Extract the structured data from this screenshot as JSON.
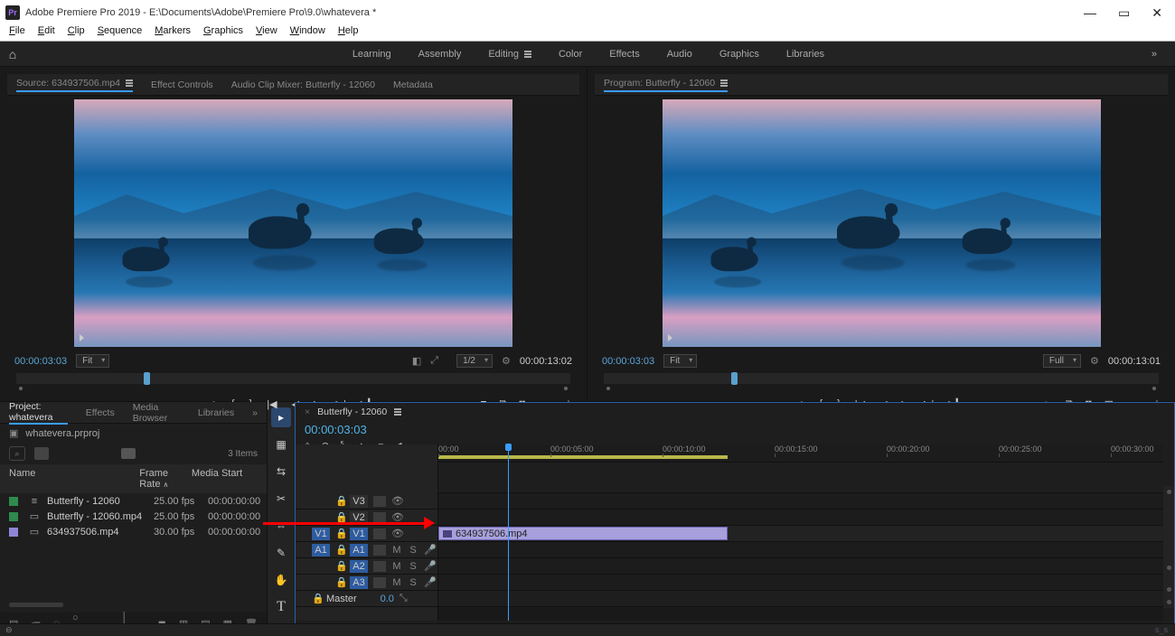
{
  "title": "Adobe Premiere Pro 2019 - E:\\Documents\\Adobe\\Premiere Pro\\9.0\\whatevera *",
  "menu": [
    "File",
    "Edit",
    "Clip",
    "Sequence",
    "Markers",
    "Graphics",
    "View",
    "Window",
    "Help"
  ],
  "workspaces": [
    "Learning",
    "Assembly",
    "Editing",
    "Color",
    "Effects",
    "Audio",
    "Graphics",
    "Libraries"
  ],
  "workspace_active": "Editing",
  "source": {
    "tab_label": "Source: 634937506.mp4",
    "other_tabs": [
      "Effect Controls",
      "Audio Clip Mixer: Butterfly - 12060",
      "Metadata"
    ],
    "timecode": "00:00:03:03",
    "fit": "Fit",
    "res": "1/2",
    "duration": "00:00:13:02"
  },
  "program": {
    "tab_label": "Program: Butterfly - 12060",
    "timecode": "00:00:03:03",
    "fit": "Fit",
    "res": "Full",
    "duration": "00:00:13:01"
  },
  "transport_icons": [
    "●",
    "{",
    "}",
    "|◀",
    "◀",
    "▶",
    "▶|",
    "▶▎",
    "⧈",
    "⧉",
    "◙"
  ],
  "program_extra_icons": [
    "✂",
    "⧉",
    "◙",
    "▦"
  ],
  "project": {
    "tabs": [
      "Project: whatevera",
      "Effects",
      "Media Browser",
      "Libraries"
    ],
    "file": "whatevera.prproj",
    "item_count": "3 Items",
    "columns": [
      "Name",
      "Frame Rate",
      "Media Start"
    ],
    "rows": [
      {
        "color": "#2e8b4d",
        "glyph": "≡",
        "name": "Butterfly - 12060",
        "fps": "25.00 fps",
        "start": "00:00:00:00"
      },
      {
        "color": "#2e8b4d",
        "glyph": "▭",
        "name": "Butterfly - 12060.mp4",
        "fps": "25.00 fps",
        "start": "00:00:00:00"
      },
      {
        "color": "#8e86d4",
        "glyph": "▭",
        "name": "634937506.mp4",
        "fps": "30.00 fps",
        "start": "00:00:00:00"
      }
    ],
    "bottom_icons": [
      "▤",
      "≔",
      "◌",
      "○——",
      "—",
      "│——",
      "◼",
      "▥",
      "▤",
      "▦",
      "🗑"
    ]
  },
  "tools": [
    "▸",
    "▦",
    "⇆",
    "✂",
    "⇔",
    "✎",
    "✋",
    "T"
  ],
  "timeline": {
    "tab": "Butterfly - 12060",
    "timecode": "00:00:03:03",
    "header_icons": [
      "⌖",
      "⊘",
      "⤡",
      "↘",
      "▾",
      "◀",
      "✧"
    ],
    "ruler": [
      "00:00",
      "00:00:05:00",
      "00:00:10:00",
      "00:00:15:00",
      "00:00:20:00",
      "00:00:25:00",
      "00:00:30:00"
    ],
    "video_tracks": [
      "V3",
      "V2",
      "V1"
    ],
    "audio_tracks": [
      "A1",
      "A2",
      "A3"
    ],
    "master_label": "Master",
    "master_value": "0.0",
    "clip_label": "634937506.mp4",
    "src_patch_v": "V1",
    "src_patch_a": "A1"
  }
}
